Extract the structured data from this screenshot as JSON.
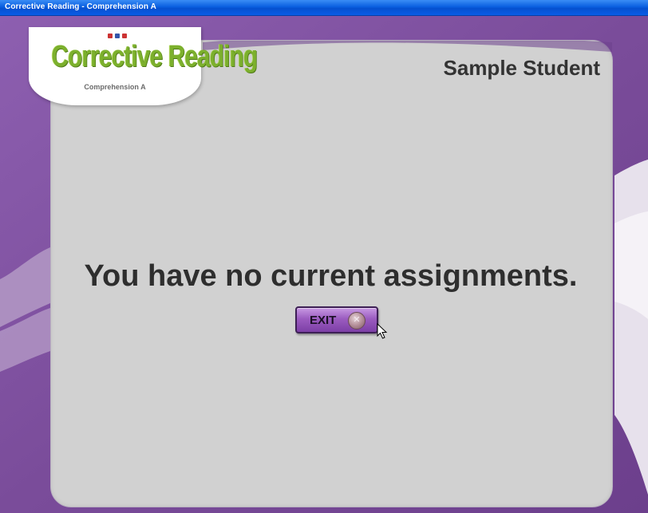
{
  "window": {
    "title": "Corrective Reading - Comprehension A"
  },
  "logo": {
    "title": "Corrective Reading",
    "subtitle": "Comprehension A",
    "mark_icon": "publisher-logo-icon"
  },
  "header": {
    "student_name": "Sample Student"
  },
  "main": {
    "message": "You have no current assignments."
  },
  "actions": {
    "exit_label": "EXIT",
    "exit_icon": "close-circle-icon"
  },
  "colors": {
    "titlebar": "#0a5fe0",
    "background_purple": "#7a4f9c",
    "panel_gray": "#d1d1d1",
    "logo_green": "#7cb02d",
    "exit_button_purple": "#9b5cc0"
  }
}
